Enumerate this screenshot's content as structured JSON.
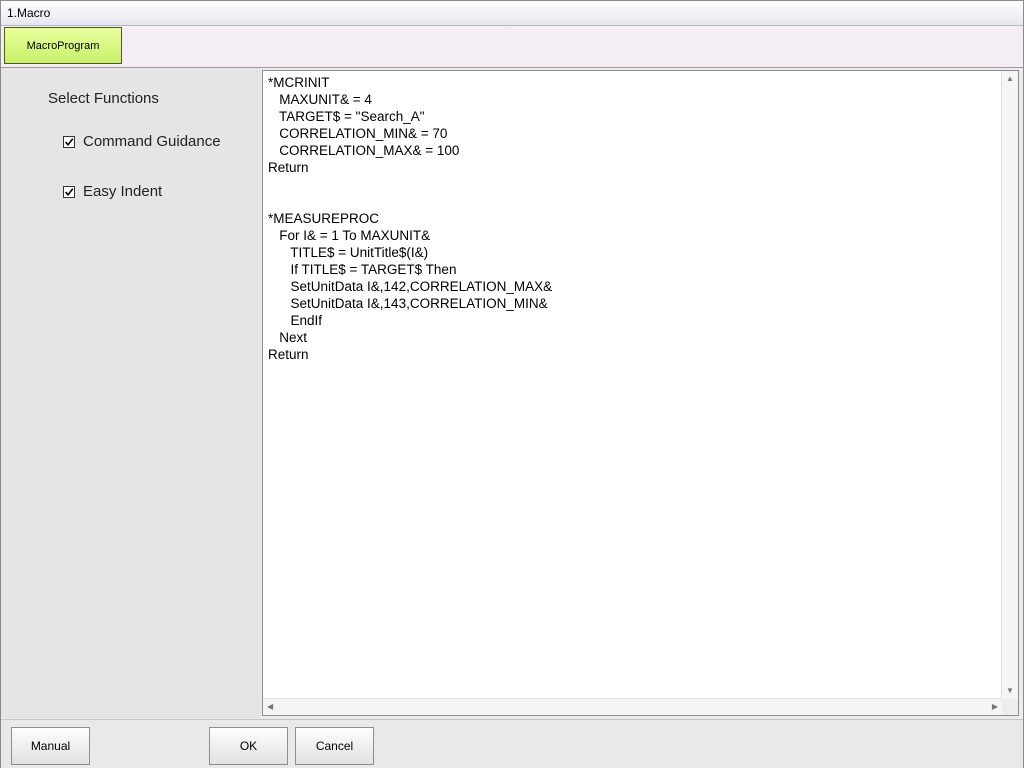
{
  "window": {
    "title": "1.Macro"
  },
  "tabs": [
    {
      "label": "MacroProgram",
      "active": true
    }
  ],
  "left_panel": {
    "title": "Select Functions",
    "options": [
      {
        "label": "Command Guidance",
        "checked": true
      },
      {
        "label": "Easy Indent",
        "checked": true
      }
    ]
  },
  "editor": {
    "lines": [
      "*MCRINIT",
      "   MAXUNIT& = 4",
      "   TARGET$ = \"Search_A\"",
      "   CORRELATION_MIN& = 70",
      "   CORRELATION_MAX& = 100",
      "Return",
      "",
      "",
      "*MEASUREPROC",
      "   For I& = 1 To MAXUNIT&",
      "      TITLE$ = UnitTitle$(I&)",
      "      If TITLE$ = TARGET$ Then",
      "      SetUnitData I&,142,CORRELATION_MAX&",
      "      SetUnitData I&,143,CORRELATION_MIN&",
      "      EndIf",
      "   Next",
      "Return"
    ]
  },
  "buttons": {
    "manual": "Manual",
    "ok": "OK",
    "cancel": "Cancel"
  },
  "colors": {
    "tab_active": "#d4f77c",
    "editor_bg": "#ffffff",
    "panel_bg": "#e5e5e5"
  }
}
